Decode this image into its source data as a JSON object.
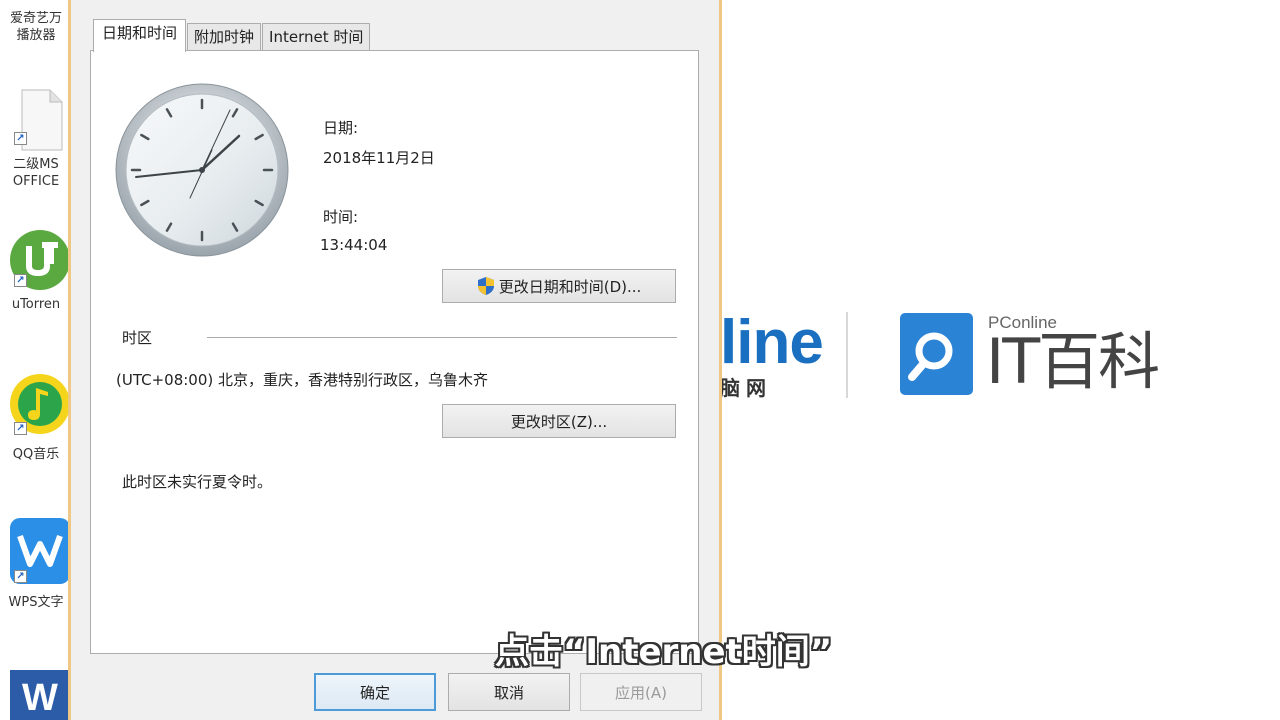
{
  "desktop": {
    "icons": [
      {
        "label_line1": "爱奇艺万",
        "label_line2": "播放器"
      },
      {
        "label_line1": "二级MS",
        "label_line2": "OFFICE"
      },
      {
        "label_line1": "uTorren",
        "label_line2": ""
      },
      {
        "label_line1": "QQ音乐",
        "label_line2": ""
      },
      {
        "label_line1": "WPS文字",
        "label_line2": ""
      },
      {
        "label_line1": "",
        "label_line2": ""
      }
    ]
  },
  "dialog": {
    "tabs": [
      {
        "label": "日期和时间"
      },
      {
        "label": "附加时钟"
      },
      {
        "label": "Internet 时间"
      }
    ],
    "date_label": "日期:",
    "date_value": "2018年11月2日",
    "time_label": "时间:",
    "time_value": "13:44:04",
    "change_datetime_button": "更改日期和时间(D)...",
    "timezone_heading": "时区",
    "timezone_value": "(UTC+08:00) 北京，重庆，香港特别行政区，乌鲁木齐",
    "change_timezone_button": "更改时区(Z)...",
    "dst_note": "此时区未实行夏令时。",
    "ok_button": "确定",
    "cancel_button": "取消",
    "apply_button": "应用(A)"
  },
  "background": {
    "pconline_text": "line",
    "pconline_sub": "脑网",
    "it_small": "PConline",
    "it_big": "IT百科"
  },
  "subtitle": "点击“Internet时间”",
  "colors": {
    "dialog_border": "#f0c885",
    "accent_blue": "#2b83d6",
    "primary_button_border": "#4d9ad8"
  }
}
